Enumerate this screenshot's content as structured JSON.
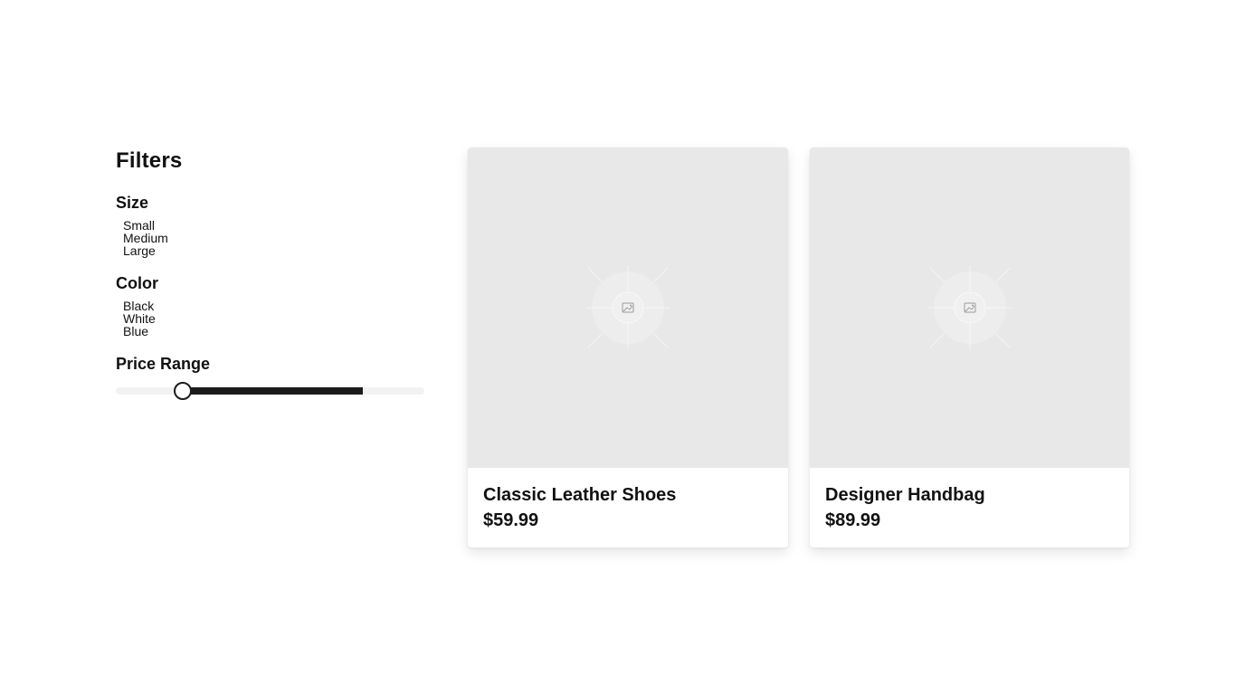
{
  "sidebar": {
    "title": "Filters",
    "groups": [
      {
        "title": "Size",
        "options": [
          "Small",
          "Medium",
          "Large"
        ]
      },
      {
        "title": "Color",
        "options": [
          "Black",
          "White",
          "Blue"
        ]
      }
    ],
    "price": {
      "title": "Price Range",
      "range_fraction": [
        0.217,
        0.801
      ]
    }
  },
  "products": [
    {
      "name": "Classic Leather Shoes",
      "price": "$59.99",
      "image_icon": "image-placeholder-icon"
    },
    {
      "name": "Designer Handbag",
      "price": "$89.99",
      "image_icon": "image-placeholder-icon"
    }
  ],
  "colors": {
    "accent": "#1c1c1c",
    "image_placeholder": "#e8e8e8",
    "track": "#f2f2f2"
  }
}
